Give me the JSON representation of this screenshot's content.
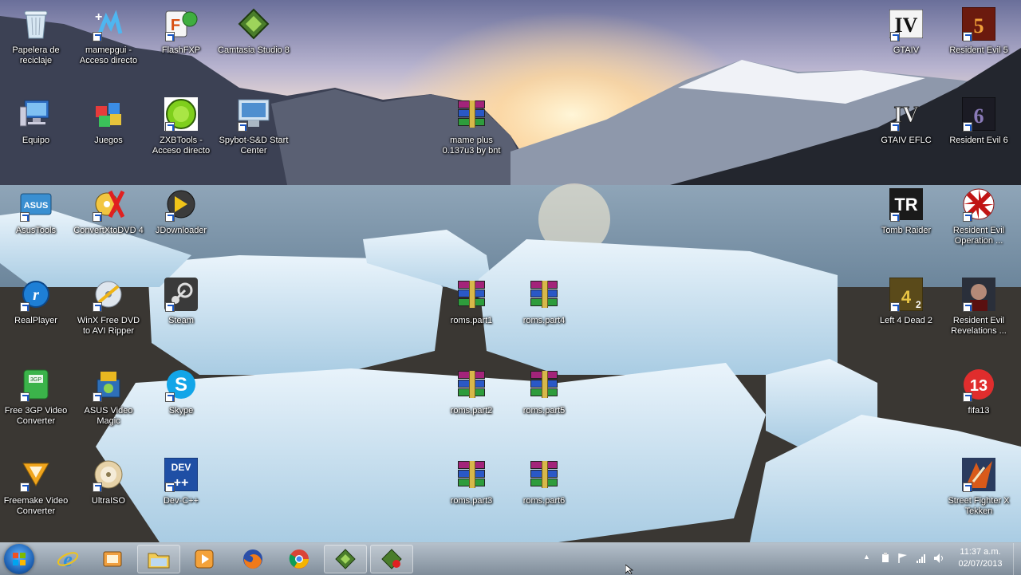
{
  "desktop": {
    "icons": [
      {
        "label": "Papelera de reciclaje",
        "icon": "recycle-bin-icon"
      },
      {
        "label": "mamepgui - Acceso directo",
        "icon": "mame-icon"
      },
      {
        "label": "FlashFXP",
        "icon": "flashfxp-icon"
      },
      {
        "label": "Camtasia Studio 8",
        "icon": "camtasia-icon"
      },
      {
        "label": "Equipo",
        "icon": "computer-icon"
      },
      {
        "label": "Juegos",
        "icon": "games-icon"
      },
      {
        "label": "ZXBTools - Acceso directo",
        "icon": "zxbtools-icon"
      },
      {
        "label": "Spybot-S&D Start Center",
        "icon": "spybot-icon"
      },
      {
        "label": "mame plus 0.137u3 by bnt",
        "icon": "winrar-archive-icon"
      },
      {
        "label": "AsusTools",
        "icon": "asus-icon"
      },
      {
        "label": "ConvertXtoDVD 4",
        "icon": "convertxtodvd-icon"
      },
      {
        "label": "JDownloader",
        "icon": "jdownloader-icon"
      },
      {
        "label": "RealPlayer",
        "icon": "realplayer-icon"
      },
      {
        "label": "WinX Free DVD to AVI Ripper",
        "icon": "winx-icon"
      },
      {
        "label": "Steam",
        "icon": "steam-icon"
      },
      {
        "label": "roms.part1",
        "icon": "winrar-archive-icon"
      },
      {
        "label": "roms.part4",
        "icon": "winrar-archive-icon"
      },
      {
        "label": "Free 3GP Video Converter",
        "icon": "3gp-icon"
      },
      {
        "label": "ASUS Video Magic",
        "icon": "asus-video-magic-icon"
      },
      {
        "label": "Skype",
        "icon": "skype-icon"
      },
      {
        "label": "roms.part2",
        "icon": "winrar-archive-icon"
      },
      {
        "label": "roms.part5",
        "icon": "winrar-archive-icon"
      },
      {
        "label": "Freemake Video Converter",
        "icon": "freemake-icon"
      },
      {
        "label": "UltraISO",
        "icon": "ultraiso-icon"
      },
      {
        "label": "Dev-C++",
        "icon": "devcpp-icon"
      },
      {
        "label": "roms.part3",
        "icon": "winrar-archive-icon"
      },
      {
        "label": "roms.part6",
        "icon": "winrar-archive-icon"
      },
      {
        "label": "GTAIV",
        "icon": "gtaiv-icon"
      },
      {
        "label": "Resident Evil 5",
        "icon": "re5-icon"
      },
      {
        "label": "GTAIV EFLC",
        "icon": "gtaiv-eflc-icon"
      },
      {
        "label": "Resident Evil 6",
        "icon": "re6-icon"
      },
      {
        "label": "Tomb Raider",
        "icon": "tomb-raider-icon"
      },
      {
        "label": "Resident Evil Operation ...",
        "icon": "re-operation-icon"
      },
      {
        "label": "Left 4 Dead 2",
        "icon": "l4d2-icon"
      },
      {
        "label": "Resident Evil Revelations ...",
        "icon": "re-revelations-icon"
      },
      {
        "label": "fifa13",
        "icon": "fifa13-icon"
      },
      {
        "label": "Street Fighter X Tekken",
        "icon": "sfxt-icon"
      }
    ]
  },
  "taskbar": {
    "clock_time": "11:37 a.m.",
    "clock_date": "02/07/2013",
    "tray_chevron": "▲"
  }
}
